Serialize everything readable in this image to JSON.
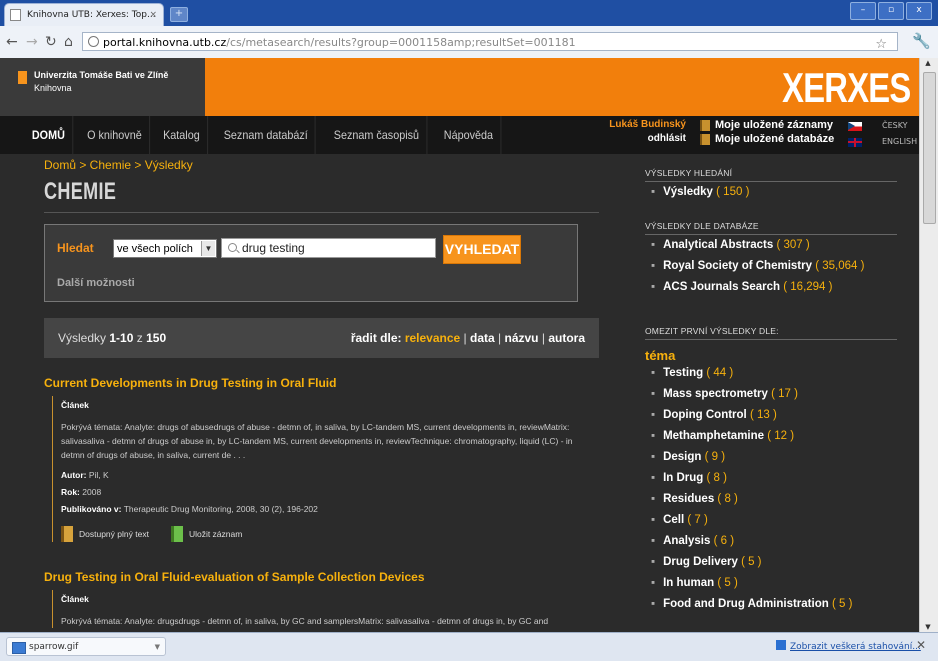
{
  "browser": {
    "tab_title": "Knihovna UTB: Xerxes: Top...",
    "tab_close": "×",
    "new_tab": "+",
    "url_host": "portal.knihovna.utb.cz",
    "url_path": "/cs/metasearch/results?group=0001158amp;resultSet=001181",
    "win_min": "–",
    "win_max": "▫",
    "win_close": "x"
  },
  "site": {
    "uni_name": "Univerzita Tomáše Bati ve Zlíně",
    "uni_sub": "Knihovna",
    "brand": "XERXES",
    "menu": [
      "DOMŮ",
      "O knihovně",
      "Katalog",
      "Seznam databází",
      "Seznam časopisů",
      "Nápověda"
    ],
    "user_name": "Lukáš Budinský",
    "logout": "odhlásit",
    "saved_records": "Moje uložené záznamy",
    "saved_databases": "Moje uložené databáze",
    "lang_cz": "ČESKY",
    "lang_en": "ENGLISH"
  },
  "main": {
    "breadcrumb": "Domů > Chemie > Výsledky",
    "title": "CHEMIE",
    "search_label": "Hledat",
    "field_select": "ve všech polích",
    "query": "drug testing",
    "search_button": "VYHLEDAT",
    "more_options": "Další možnosti",
    "results_prefix": "Výsledky",
    "results_range": "1-10",
    "results_of": "z",
    "results_total": "150",
    "sort_label": "řadit dle:",
    "sort_options": [
      "relevance",
      "data",
      "názvu",
      "autora"
    ]
  },
  "results": [
    {
      "title": "Current Developments in Drug Testing in Oral Fluid",
      "type": "Článek",
      "topics_label": "Pokrývá témata:",
      "topics": "Analyte: drugs of abusedrugs of abuse - detmn of, in saliva, by LC-tandem MS, current developments in, reviewMatrix: salivasaliva - detmn of drugs of abuse in, by LC-tandem MS, current developments in, reviewTechnique: chromatography, liquid (LC) - in detmn of drugs of abuse, in saliva, current de . . .",
      "author_label": "Autor:",
      "author": "Pil, K",
      "year_label": "Rok:",
      "year": "2008",
      "published_label": "Publikováno v:",
      "published": "Therapeutic Drug Monitoring, 2008, 30 (2), 196-202",
      "fulltext": "Dostupný plný text",
      "save": "Uložit záznam"
    },
    {
      "title": "Drug Testing in Oral Fluid-evaluation of Sample Collection Devices",
      "type": "Článek",
      "topics_label": "Pokrývá témata:",
      "topics": "Analyte: drugsdrugs - detmn of, in saliva, by GC and samplersMatrix: salivasaliva - detmn of drugs in, by GC and"
    }
  ],
  "sidebar": {
    "search_results_head": "VÝSLEDKY HLEDÁNÍ",
    "search_results": [
      {
        "label": "Výsledky",
        "count": "( 150 )"
      }
    ],
    "db_head": "VÝSLEDKY DLE DATABÁZE",
    "databases": [
      {
        "label": "Analytical Abstracts",
        "count": "( 307 )"
      },
      {
        "label": "Royal Society of Chemistry",
        "count": "( 35,064 )"
      },
      {
        "label": "ACS Journals Search",
        "count": "( 16,294 )"
      }
    ],
    "limit_head": "OMEZIT PRVNÍ VÝSLEDKY DLE:",
    "topic_head": "téma",
    "topics": [
      {
        "label": "Testing",
        "count": "( 44 )"
      },
      {
        "label": "Mass spectrometry",
        "count": "( 17 )"
      },
      {
        "label": "Doping Control",
        "count": "( 13 )"
      },
      {
        "label": "Methamphetamine",
        "count": "( 12 )"
      },
      {
        "label": "Design",
        "count": "( 9 )"
      },
      {
        "label": "In Drug",
        "count": "( 8 )"
      },
      {
        "label": "Residues",
        "count": "( 8 )"
      },
      {
        "label": "Cell",
        "count": "( 7 )"
      },
      {
        "label": "Analysis",
        "count": "( 6 )"
      },
      {
        "label": "Drug Delivery",
        "count": "( 5 )"
      },
      {
        "label": "In human",
        "count": "( 5 )"
      },
      {
        "label": "Food and Drug Administration",
        "count": "( 5 )"
      }
    ]
  },
  "downloads": {
    "file": "sparrow.gif",
    "show_all": "Zobrazit veškerá stahování..."
  },
  "colors": {
    "accent": "#f7941d",
    "link": "#f7b10d",
    "background": "#2b2b2b"
  }
}
